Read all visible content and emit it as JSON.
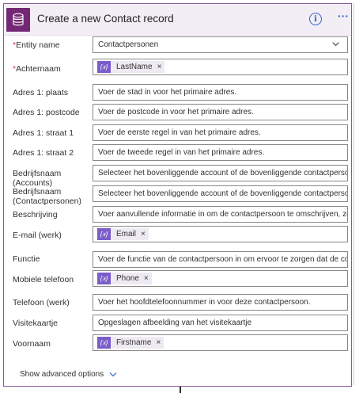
{
  "header": {
    "title": "Create a new Contact record",
    "app_icon": "database-icon",
    "info_icon": "info-icon",
    "more_icon": "more-dots-icon",
    "accent": "#742774"
  },
  "fields": [
    {
      "label": "Entity name",
      "required": true,
      "type": "dropdown",
      "value": "Contactpersonen"
    },
    {
      "label": "Achternaam",
      "required": true,
      "type": "token",
      "token": "LastName"
    },
    {
      "label": "Adres 1: plaats",
      "type": "text",
      "placeholder": "Voer de stad in voor het primaire adres."
    },
    {
      "label": "Adres 1: postcode",
      "type": "text",
      "placeholder": "Voer de postcode in voor het primaire adres."
    },
    {
      "label": "Adres 1: straat 1",
      "type": "text",
      "placeholder": "Voer de eerste regel in van het primaire adres."
    },
    {
      "label": "Adres 1: straat 2",
      "type": "text",
      "placeholder": "Voer de tweede regel in van het primaire adres."
    },
    {
      "label": "Bedrijfsnaam (Accounts)",
      "type": "text",
      "placeholder": "Selecteer het bovenliggende account of de bovenliggende contactpersoon voor de co"
    },
    {
      "label": "Bedrijfsnaam (Contactpersonen)",
      "type": "text",
      "placeholder": "Selecteer het bovenliggende account of de bovenliggende contactpersoon voor de co"
    },
    {
      "label": "Beschrijving",
      "type": "text",
      "placeholder": "Voer aanvullende informatie in om de contactpersoon te omschrijven, zoals een fragr"
    },
    {
      "label": "E-mail (werk)",
      "type": "token",
      "token": "Email"
    },
    {
      "label": "Functie",
      "type": "text",
      "placeholder": "Voer de functie van de contactpersoon in om ervoor te zorgen dat de contactpersoon"
    },
    {
      "label": "Mobiele telefoon",
      "type": "token",
      "token": "Phone"
    },
    {
      "label": "Telefoon (werk)",
      "type": "text",
      "placeholder": "Voer het hoofdtelefoonnummer in voor deze contactpersoon."
    },
    {
      "label": "Visitekaartje",
      "type": "text",
      "placeholder": "Opgeslagen afbeelding van het visitekaartje"
    },
    {
      "label": "Voornaam",
      "type": "token",
      "token": "Firstname"
    }
  ],
  "token_icon_glyph": "{𝑥}",
  "token_remove": "×",
  "advanced_label": "Show advanced options",
  "colors": {
    "token_bg": "#eeeaf3",
    "token_icon": "#7b5cc8",
    "link": "#2b64c8",
    "required": "#c8364e"
  }
}
